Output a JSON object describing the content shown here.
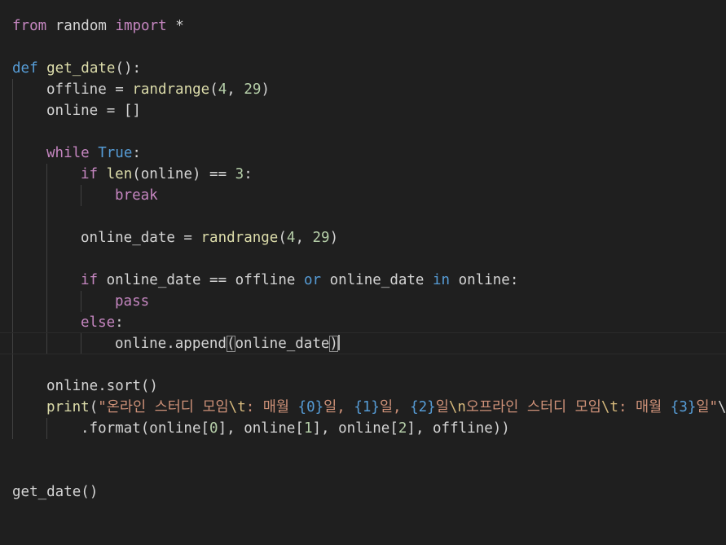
{
  "editor": {
    "language": "python",
    "lines": {
      "l1": "from random import *",
      "l3": "def get_date():",
      "l4": "offline = randrange(4, 29)",
      "l5": "online = []",
      "l7": "while True:",
      "l8": "if len(online) == 3:",
      "l9": "break",
      "l11": "online_date = randrange(4, 29)",
      "l13": "if online_date == offline or online_date in online:",
      "l14": "pass",
      "l15": "else:",
      "l16": "online.append(online_date)",
      "l18": "online.sort()",
      "l19": "print(\"온라인 스터디 모임\\t: 매월 {0}일, {1}일, {2}일\\n오프라인 스터디 모임\\t: 매월 {3}일\"\\",
      "l20": ".format(online[0], online[1], online[2], offline))",
      "l23": "get_date()"
    }
  },
  "tokens": {
    "from": "from",
    "random": " random ",
    "import": "import",
    "star": " *",
    "def": "def",
    "get_date": " get_date",
    "paren_colon": "():",
    "offline_eq": "offline = ",
    "randrange": "randrange",
    "open": "(",
    "n4": "4",
    "comma": ", ",
    "n29": "29",
    "close": ")",
    "online_eq_list": "online = []",
    "while": "while",
    "true": "True",
    "colon": ":",
    "if": "if",
    "len": "len",
    "online_paren": "(online) == ",
    "n3": "3",
    "break": "break",
    "online_date_eq": "online_date = ",
    "online_date_cmp": " online_date == offline ",
    "or": "or",
    "online_date_mid": " online_date ",
    "in": "in",
    "online_colon": " online:",
    "pass": "pass",
    "else": "else",
    "online_append": "online.append",
    "online_date_arg": "online_date",
    "online_sort": "online.sort()",
    "print": "print",
    "s1": "\"온라인 스터디 모임",
    "tab": "\\t",
    "s2": ": 매월 ",
    "f0": "{0}",
    "s3": "일, ",
    "f1": "{1}",
    "f2": "{2}",
    "s5": "일",
    "nl": "\\n",
    "s6": "오프라인 스터디 모임",
    "s7": ": 매월 ",
    "f3": "{3}",
    "s8": "일\"",
    "backslash": "\\",
    "format_line": ".format(online[",
    "n0": "0",
    "mid1": "], online[",
    "n1": "1",
    "mid2": "], online[",
    "n2": "2",
    "tail": "], offline))",
    "call": "get_date()"
  }
}
